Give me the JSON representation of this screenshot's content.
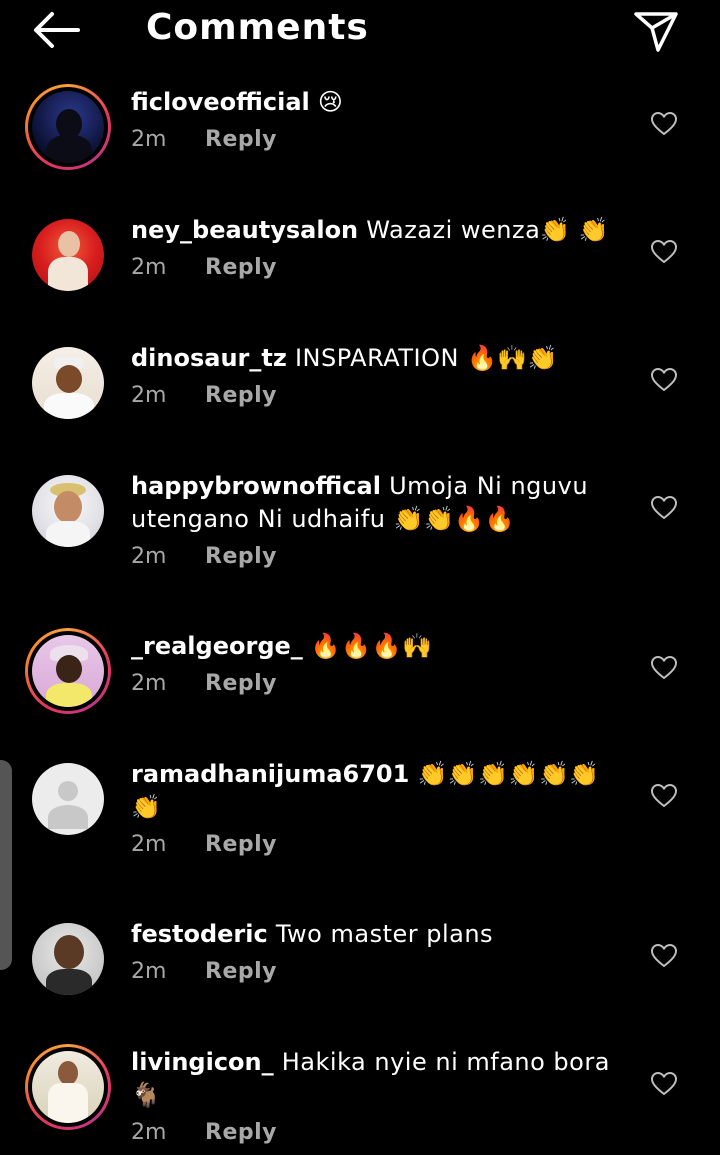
{
  "header": {
    "title": "Comments",
    "back_icon": "arrow-left-icon",
    "send_icon": "paper-plane-icon"
  },
  "comments": [
    {
      "username": "ficloveofficial",
      "text": " 😢",
      "time": "2m",
      "reply": "Reply",
      "story_ring": true
    },
    {
      "username": "ney_beautysalon",
      "text": " Wazazi wenza👏 👏",
      "time": "2m",
      "reply": "Reply",
      "story_ring": false
    },
    {
      "username": "dinosaur_tz",
      "text": " INSPARATION 🔥🙌👏",
      "time": "2m",
      "reply": "Reply",
      "story_ring": false
    },
    {
      "username": "happybrownoffical",
      "text": " Umoja Ni nguvu utengano Ni udhaifu 👏👏🔥🔥",
      "time": "2m",
      "reply": "Reply",
      "story_ring": false
    },
    {
      "username": "_realgeorge_",
      "text": " 🔥🔥🔥🙌",
      "time": "2m",
      "reply": "Reply",
      "story_ring": true
    },
    {
      "username": "ramadhanijuma6701",
      "text": " 👏👏👏👏👏👏 👏",
      "time": "2m",
      "reply": "Reply",
      "story_ring": false
    },
    {
      "username": "festoderic",
      "text": " Two master plans",
      "time": "2m",
      "reply": "Reply",
      "story_ring": false
    },
    {
      "username": "livingicon_",
      "text": " Hakika nyie ni mfano bora 🐐",
      "time": "2m",
      "reply": "Reply",
      "story_ring": true
    }
  ],
  "icons": {
    "like": "heart-outline-icon"
  },
  "colors": {
    "background": "#000000",
    "text": "#ffffff",
    "muted": "#a8a8a8",
    "ring_start": "#f9a03f",
    "ring_end": "#c13584"
  }
}
